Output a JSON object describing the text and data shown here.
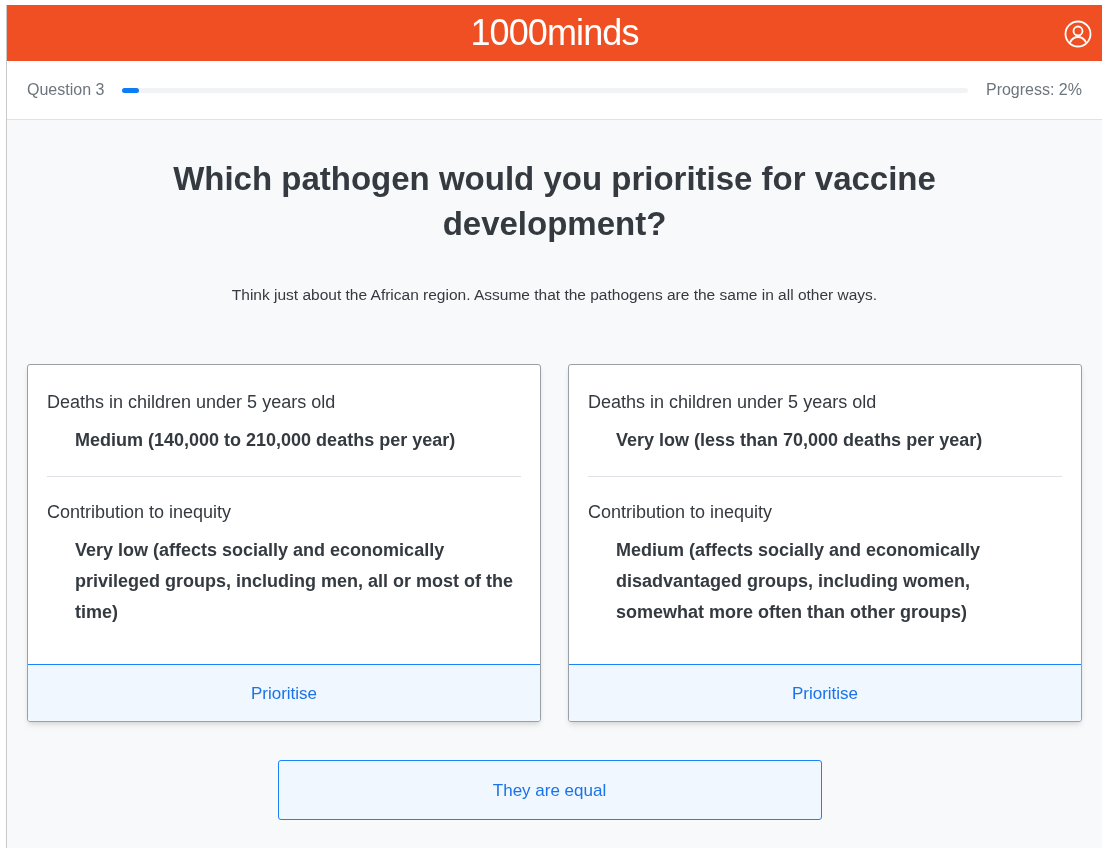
{
  "header": {
    "logo": "1000**minds**"
  },
  "progress": {
    "question": "Question 3",
    "level": 0.02,
    "reading": "Progress: 2%"
  },
  "question": {
    "title": "Which pathogen would you prioritise for vaccine development?",
    "instruction": "Think just about the African region. Assume that the pathogens are the same in all other ways."
  },
  "options": [
    {
      "criteria": [
        {
          "name": "Deaths in children under 5 years old",
          "level_text": "Medium (140,000 to 210,000 deaths per year)"
        },
        {
          "name": "Contribution to inequity",
          "level_text": "Very low (affects socially and economically privileged groups, including men, all or most of the time)"
        }
      ],
      "button": "Prioritise"
    },
    {
      "criteria": [
        {
          "name": "Deaths in children under 5 years old",
          "level_text": "Very low (less than 70,000 deaths per year)"
        },
        {
          "name": "Contribution to inequity",
          "level_text": "Medium (affects socially and economically disadvantaged groups, including women, somewhat more often than other groups)"
        }
      ],
      "button": "Prioritise"
    }
  ],
  "equal_button": "They are equal"
}
